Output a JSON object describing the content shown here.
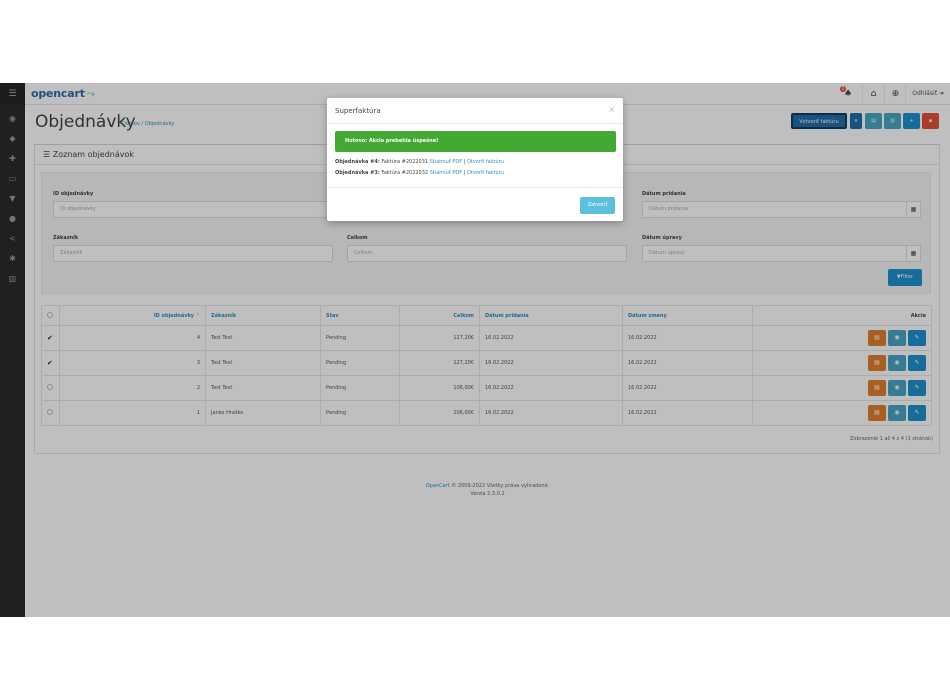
{
  "app": {
    "logo_text": "opencart",
    "logo_suffix": "⤳",
    "notification_count": "1",
    "logout_label": "Odhlásiť"
  },
  "page": {
    "title": "Objednávky",
    "breadcrumb_home": "Domov",
    "breadcrumb_sep": "/",
    "breadcrumb_current": "Objednávky",
    "invoice_button": "Vytvoriť faktúru"
  },
  "panel": {
    "title": "Zoznam objednávok"
  },
  "filter": {
    "order_id_label": "ID objednávky",
    "order_id_placeholder": "ID objednávky",
    "customer_label": "Zákazník",
    "customer_placeholder": "Zákazník",
    "total_label": "Celkom",
    "total_placeholder": "Celkom",
    "date_added_label": "Dátum pridania",
    "date_added_placeholder": "Dátum pridania",
    "date_modified_label": "Dátum úpravy",
    "date_modified_placeholder": "Dátum úpravy",
    "filter_button": "Filter"
  },
  "table": {
    "headers": {
      "order_id": "ID objednávky",
      "customer": "Zákazník",
      "status": "Stav",
      "total": "Celkom",
      "date_added": "Dátum pridania",
      "date_modified": "Dátum zmeny",
      "action": "Akcie"
    },
    "rows": [
      {
        "checked": true,
        "id": "4",
        "customer": "Test Test",
        "status": "Pending",
        "total": "127,20€",
        "date_added": "16.02.2022",
        "date_modified": "16.02.2022"
      },
      {
        "checked": true,
        "id": "3",
        "customer": "Test Test",
        "status": "Pending",
        "total": "127,20€",
        "date_added": "16.02.2022",
        "date_modified": "16.02.2022"
      },
      {
        "checked": false,
        "id": "2",
        "customer": "Test Test",
        "status": "Pending",
        "total": "106,00€",
        "date_added": "16.02.2022",
        "date_modified": "16.02.2022"
      },
      {
        "checked": false,
        "id": "1",
        "customer": "Janko Hraško",
        "status": "Pending",
        "total": "106,00€",
        "date_added": "16.02.2022",
        "date_modified": "16.02.2022"
      }
    ],
    "pager_info": "Zobrazenie 1 až 4 z 4 (1 stránok)"
  },
  "footer": {
    "brand": "OpenCart",
    "copyright": "© 2009-2022 Všetky práva vyhradené.",
    "version": "Verzia 2.3.0.2"
  },
  "modal": {
    "title": "Superfaktúra",
    "close_x": "×",
    "alert": "Hotovo: Akcia prebehla úspešne!",
    "results": [
      {
        "label": "Objednávka #4:",
        "invoice": "Faktúra #2022031",
        "pdf_link": "Stiahnuť PDF",
        "sep": "|",
        "open_link": "Otvoriť faktúru"
      },
      {
        "label": "Objednávka #3:",
        "invoice": "Faktúra #2022032",
        "pdf_link": "Stiahnuť PDF",
        "sep": "|",
        "open_link": "Otvoriť faktúru"
      }
    ],
    "close_button": "Zatvoriť"
  },
  "colors": {
    "primary": "#1e91cf",
    "success": "#43a932",
    "warning": "#e17f2d",
    "info": "#5bc0de",
    "danger": "#e3503e"
  }
}
